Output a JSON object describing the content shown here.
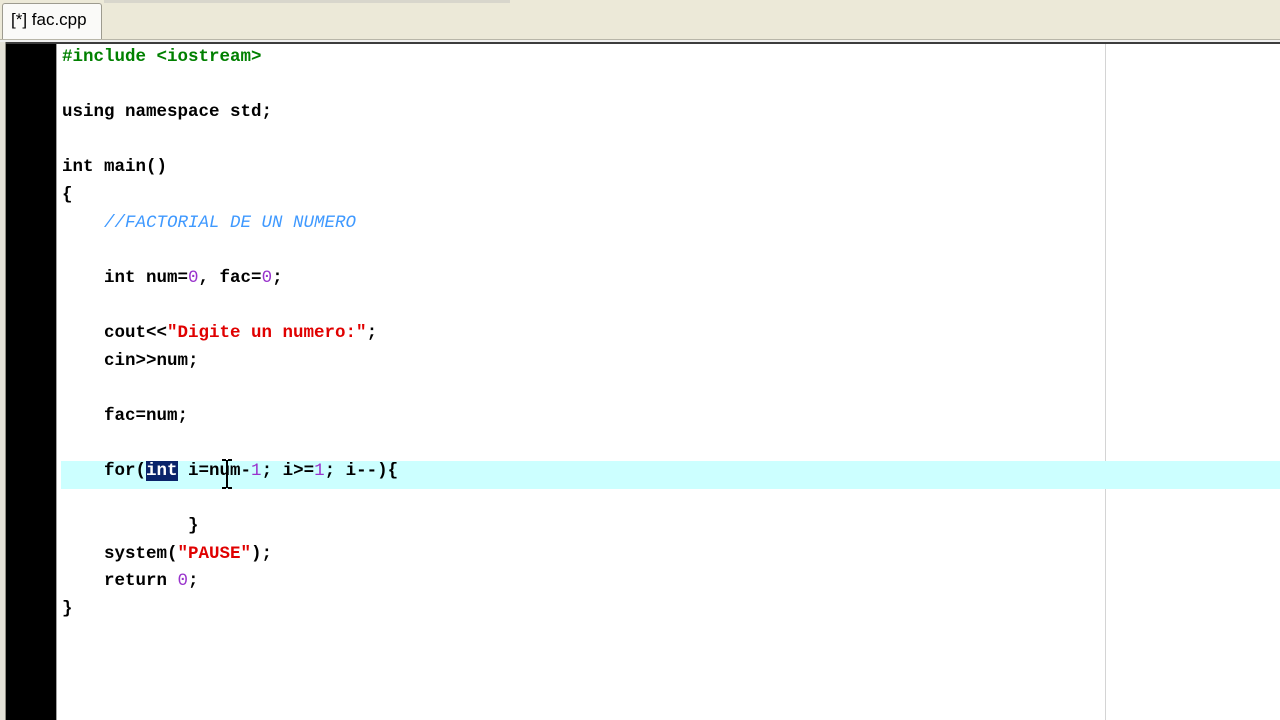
{
  "tab": {
    "label": "[*] fac.cpp"
  },
  "editor": {
    "lines": [
      {
        "segments": [
          {
            "t": "#include <iostream>",
            "c": "pp"
          }
        ]
      },
      {
        "segments": []
      },
      {
        "segments": [
          {
            "t": "using namespace std;",
            "c": ""
          }
        ]
      },
      {
        "segments": []
      },
      {
        "segments": [
          {
            "t": "int main()",
            "c": ""
          }
        ]
      },
      {
        "segments": [
          {
            "t": "{",
            "c": ""
          }
        ]
      },
      {
        "segments": [
          {
            "t": "    ",
            "c": ""
          },
          {
            "t": "//FACTORIAL DE UN NUMERO",
            "c": "cm"
          }
        ]
      },
      {
        "segments": []
      },
      {
        "segments": [
          {
            "t": "    int num=",
            "c": ""
          },
          {
            "t": "0",
            "c": "num"
          },
          {
            "t": ", fac=",
            "c": ""
          },
          {
            "t": "0",
            "c": "num"
          },
          {
            "t": ";",
            "c": ""
          }
        ]
      },
      {
        "segments": []
      },
      {
        "segments": [
          {
            "t": "    cout<<",
            "c": ""
          },
          {
            "t": "\"Digite un numero:\"",
            "c": "str"
          },
          {
            "t": ";",
            "c": ""
          }
        ]
      },
      {
        "segments": [
          {
            "t": "    cin>>num;",
            "c": ""
          }
        ]
      },
      {
        "segments": []
      },
      {
        "segments": [
          {
            "t": "    fac=num;",
            "c": ""
          }
        ]
      },
      {
        "segments": []
      },
      {
        "segments": [
          {
            "t": "    for(",
            "c": ""
          },
          {
            "t": "int",
            "c": "sel"
          },
          {
            "t": " i=num-",
            "c": ""
          },
          {
            "t": "1",
            "c": "num"
          },
          {
            "t": "; i>=",
            "c": ""
          },
          {
            "t": "1",
            "c": "num"
          },
          {
            "t": "; i--){",
            "c": ""
          }
        ]
      },
      {
        "segments": []
      },
      {
        "segments": [
          {
            "t": "            }",
            "c": ""
          }
        ]
      },
      {
        "segments": [
          {
            "t": "    system(",
            "c": ""
          },
          {
            "t": "\"PAUSE\"",
            "c": "str"
          },
          {
            "t": ");",
            "c": ""
          }
        ]
      },
      {
        "segments": [
          {
            "t": "    return ",
            "c": ""
          },
          {
            "t": "0",
            "c": "num"
          },
          {
            "t": ";",
            "c": ""
          }
        ]
      },
      {
        "segments": [
          {
            "t": "}",
            "c": ""
          }
        ]
      }
    ]
  },
  "colors": {
    "current_line": "#ccffff",
    "preprocessor": "#008000",
    "comment": "#3f99ff",
    "string": "#e00000",
    "number": "#9933cc",
    "selection": "#0a246a"
  }
}
